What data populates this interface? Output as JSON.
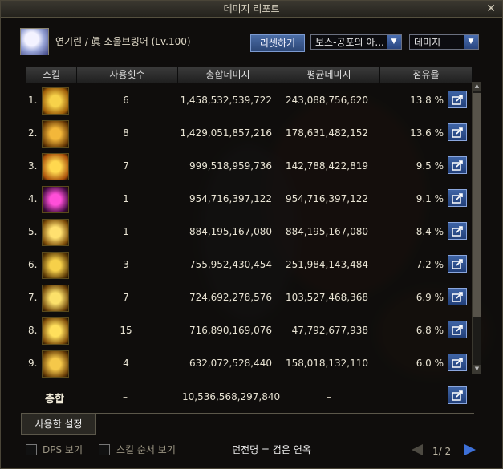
{
  "window": {
    "title": "데미지 리포트",
    "close": "✕"
  },
  "character": {
    "name": "연기린 / 眞 소울브링어 (Lv.100)",
    "avatar_icon": "character-portrait-icon"
  },
  "controls": {
    "reset_label": "리셋하기",
    "target_select": "보스-공포의 아...",
    "type_select": "데미지"
  },
  "columns": [
    "스킬",
    "사용횟수",
    "총합데미지",
    "평균데미지",
    "점유율"
  ],
  "rows": [
    {
      "rank": "1.",
      "uses": "6",
      "total": "1,458,532,539,722",
      "avg": "243,088,756,620",
      "share": "13.8 %",
      "icon": "skill-icon-1"
    },
    {
      "rank": "2.",
      "uses": "8",
      "total": "1,429,051,857,216",
      "avg": "178,631,482,152",
      "share": "13.6 %",
      "icon": "skill-icon-2"
    },
    {
      "rank": "3.",
      "uses": "7",
      "total": "999,518,959,736",
      "avg": "142,788,422,819",
      "share": "9.5 %",
      "icon": "skill-icon-3"
    },
    {
      "rank": "4.",
      "uses": "1",
      "total": "954,716,397,122",
      "avg": "954,716,397,122",
      "share": "9.1 %",
      "icon": "skill-icon-4"
    },
    {
      "rank": "5.",
      "uses": "1",
      "total": "884,195,167,080",
      "avg": "884,195,167,080",
      "share": "8.4 %",
      "icon": "skill-icon-5"
    },
    {
      "rank": "6.",
      "uses": "3",
      "total": "755,952,430,454",
      "avg": "251,984,143,484",
      "share": "7.2 %",
      "icon": "skill-icon-6"
    },
    {
      "rank": "7.",
      "uses": "7",
      "total": "724,692,278,576",
      "avg": "103,527,468,368",
      "share": "6.9 %",
      "icon": "skill-icon-7"
    },
    {
      "rank": "8.",
      "uses": "15",
      "total": "716,890,169,076",
      "avg": "47,792,677,938",
      "share": "6.8 %",
      "icon": "skill-icon-8"
    },
    {
      "rank": "9.",
      "uses": "4",
      "total": "632,072,528,440",
      "avg": "158,018,132,110",
      "share": "6.0 %",
      "icon": "skill-icon-9"
    }
  ],
  "total": {
    "label": "총합",
    "uses": "–",
    "total": "10,536,568,297,840",
    "avg": "–"
  },
  "used_settings_tab": "사용한 설정",
  "footer": {
    "dps_label": "DPS 보기",
    "skill_order_label": "스킬 순서 보기",
    "dungeon_label": "던전명 = 검은 연옥",
    "page": "1/ 2"
  },
  "colors": {
    "accent": "#3d6bc0",
    "export": "#2b4f91",
    "window": "#0e0d0b"
  }
}
